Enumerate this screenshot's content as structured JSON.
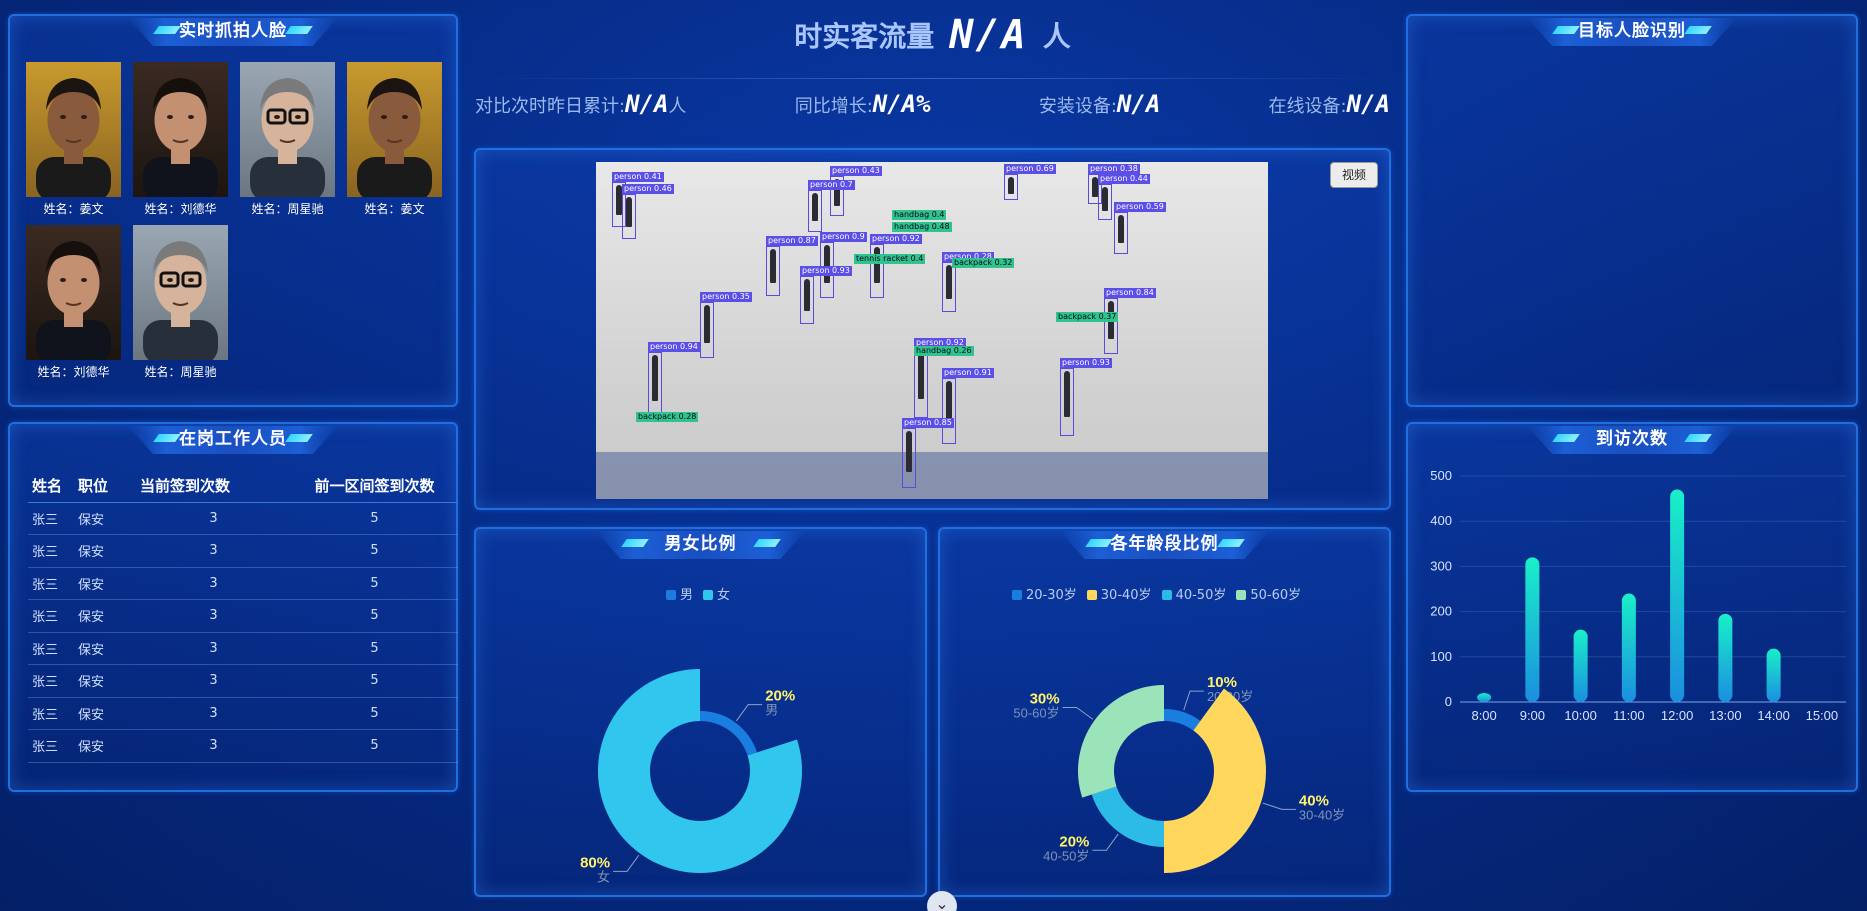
{
  "panels": {
    "faces_title": "实时抓拍人脸",
    "staff_title": "在岗工作人员",
    "target_title": "目标人脸识别",
    "gender_title": "男女比例",
    "age_title": "各年龄段比例",
    "visits_title": "到访次数"
  },
  "faces": [
    {
      "name": "姓名：姜文",
      "variant": "a"
    },
    {
      "name": "姓名：刘德华",
      "variant": "b"
    },
    {
      "name": "姓名：周星驰",
      "variant": "c"
    },
    {
      "name": "姓名：姜文",
      "variant": "a"
    },
    {
      "name": "姓名：刘德华",
      "variant": "b"
    },
    {
      "name": "姓名：周星驰",
      "variant": "c"
    }
  ],
  "staff": {
    "headers": [
      "姓名",
      "职位",
      "当前签到次数",
      "前一区间签到次数"
    ],
    "rows": [
      [
        "张三",
        "保安",
        "3",
        "5"
      ],
      [
        "张三",
        "保安",
        "3",
        "5"
      ],
      [
        "张三",
        "保安",
        "3",
        "5"
      ],
      [
        "张三",
        "保安",
        "3",
        "5"
      ],
      [
        "张三",
        "保安",
        "3",
        "5"
      ],
      [
        "张三",
        "保安",
        "3",
        "5"
      ],
      [
        "张三",
        "保安",
        "3",
        "5"
      ],
      [
        "张三",
        "保安",
        "3",
        "5"
      ]
    ]
  },
  "hero": {
    "label": "时实客流量",
    "value": "N/A",
    "unit": "人"
  },
  "stats": [
    {
      "label": "对比次时昨日累计:",
      "value": "N/A",
      "unit": "人"
    },
    {
      "label": "同比增长:",
      "value": "N/A%",
      "unit": ""
    },
    {
      "label": "安装设备:",
      "value": "N/A",
      "unit": ""
    },
    {
      "label": "在线设备:",
      "value": "N/A",
      "unit": ""
    }
  ],
  "video": {
    "button_label": "视频",
    "detections": [
      {
        "label": "person 0.41",
        "kind": "person"
      },
      {
        "label": "person 0.46",
        "kind": "person"
      },
      {
        "label": "person 0.43",
        "kind": "person"
      },
      {
        "label": "person 0.7",
        "kind": "person"
      },
      {
        "label": "person 0.69",
        "kind": "person"
      },
      {
        "label": "person 0.38",
        "kind": "person"
      },
      {
        "label": "person 0.44",
        "kind": "person"
      },
      {
        "label": "person 0.59",
        "kind": "person"
      },
      {
        "label": "handbag 0.4",
        "kind": "bag"
      },
      {
        "label": "handbag 0.48",
        "kind": "bag"
      },
      {
        "label": "person 0.87",
        "kind": "person"
      },
      {
        "label": "person 0.9",
        "kind": "person"
      },
      {
        "label": "person 0.92",
        "kind": "person"
      },
      {
        "label": "person 0.93",
        "kind": "person"
      },
      {
        "label": "tennis racket 0.4",
        "kind": "bag"
      },
      {
        "label": "person 0.28",
        "kind": "person"
      },
      {
        "label": "backpack 0.32",
        "kind": "bag"
      },
      {
        "label": "person 0.35",
        "kind": "person"
      },
      {
        "label": "person 0.84",
        "kind": "person"
      },
      {
        "label": "backpack 0.37",
        "kind": "bag"
      },
      {
        "label": "person 0.94",
        "kind": "person"
      },
      {
        "label": "person 0.92",
        "kind": "person"
      },
      {
        "label": "handbag 0.26",
        "kind": "bag"
      },
      {
        "label": "person 0.91",
        "kind": "person"
      },
      {
        "label": "person 0.93",
        "kind": "person"
      },
      {
        "label": "backpack 0.28",
        "kind": "bag"
      },
      {
        "label": "person 0.85",
        "kind": "person"
      }
    ]
  },
  "colors": {
    "male": "#1a7de0",
    "female": "#30c6ee",
    "age_20_30": "#1a7de0",
    "age_30_40": "#ffd75c",
    "age_40_50": "#2bbbe6",
    "age_50_60": "#9be3b8",
    "bar_top": "#19f0c8",
    "bar_bottom": "#1a8fe0",
    "label_highlight": "#fff36a"
  },
  "gender": {
    "legend": [
      "男",
      "女"
    ],
    "labels": [
      {
        "pct": "20%",
        "name": "男"
      },
      {
        "pct": "80%",
        "name": "女"
      }
    ],
    "chart_data": {
      "type": "pie",
      "categories": [
        "男",
        "女"
      ],
      "values": [
        20,
        80
      ]
    }
  },
  "age": {
    "legend": [
      "20-30岁",
      "30-40岁",
      "40-50岁",
      "50-60岁"
    ],
    "labels": [
      {
        "pct": "10%",
        "name": "20-30岁"
      },
      {
        "pct": "40%",
        "name": "30-40岁"
      },
      {
        "pct": "20%",
        "name": "40-50岁"
      },
      {
        "pct": "30%",
        "name": "50-60岁"
      }
    ],
    "chart_data": {
      "type": "pie",
      "categories": [
        "20-30岁",
        "30-40岁",
        "40-50岁",
        "50-60岁"
      ],
      "values": [
        10,
        40,
        20,
        30
      ]
    }
  },
  "chart_data": {
    "type": "bar",
    "categories": [
      "8:00",
      "9:00",
      "10:00",
      "11:00",
      "12:00",
      "13:00",
      "14:00",
      "15:00"
    ],
    "values": [
      20,
      320,
      160,
      240,
      470,
      195,
      118,
      null
    ],
    "ylim": [
      0,
      500
    ],
    "yticks": [
      0,
      100,
      200,
      300,
      400,
      500
    ],
    "grid": true
  }
}
